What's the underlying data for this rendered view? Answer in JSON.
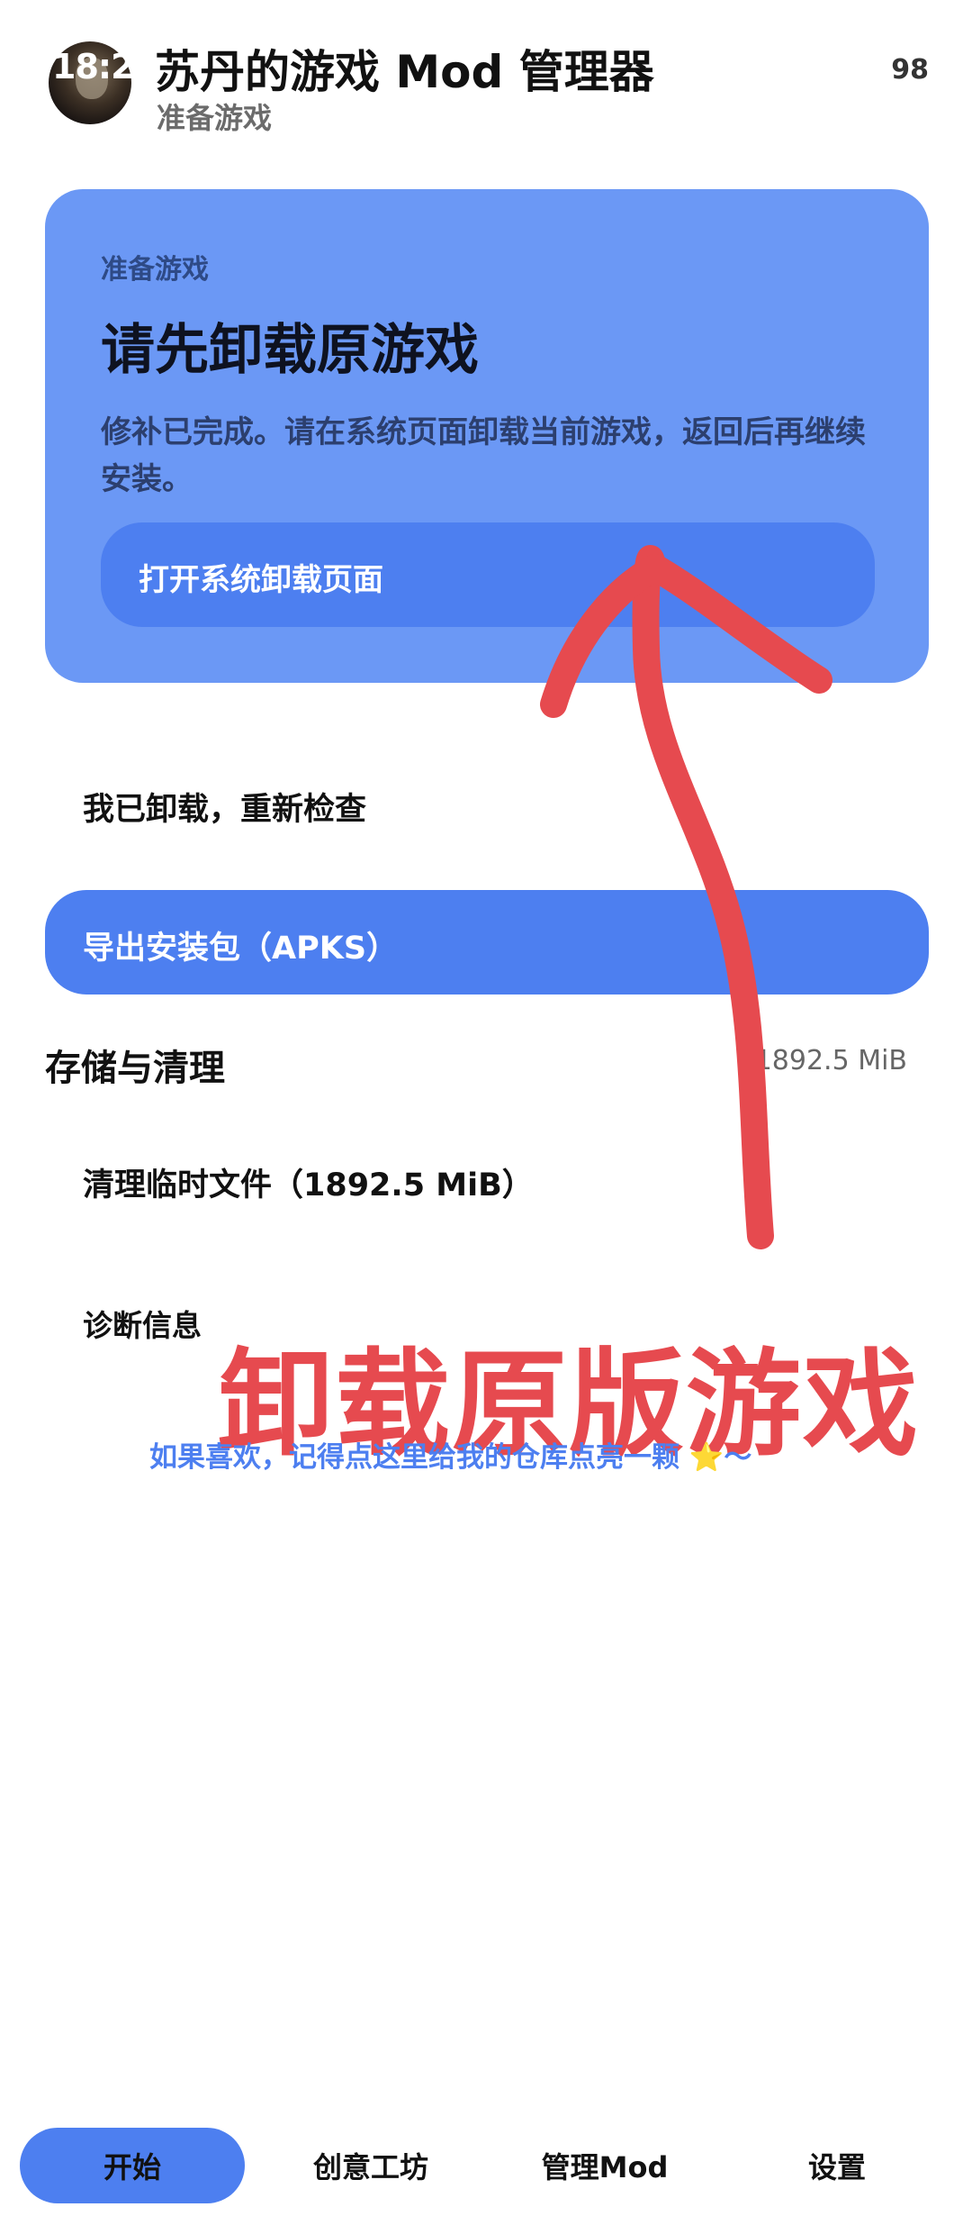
{
  "status": {
    "time": "18:2",
    "battery": "98"
  },
  "header": {
    "title": "苏丹的游戏 Mod 管理器",
    "subtitle": "准备游戏"
  },
  "card": {
    "eyebrow": "准备游戏",
    "title": "请先卸载原游戏",
    "description": "修补已完成。请在系统页面卸载当前游戏，返回后再继续安装。",
    "button_label": "打开系统卸载页面"
  },
  "actions": {
    "recheck_label": "我已卸载，重新检查",
    "export_label": "导出安装包（APKS）"
  },
  "storage": {
    "title": "存储与清理",
    "size": "1892.5 MiB",
    "clean_label": "清理临时文件（1892.5 MiB）",
    "diagnostics_label": "诊断信息"
  },
  "overlay": {
    "caption": "卸载原版游戏",
    "promo": "如果喜欢，记得点这里给我的仓库点亮一颗 ⭐～",
    "arrow_color": "#e64a4f"
  },
  "nav": {
    "items": [
      {
        "label": "开始",
        "active": true
      },
      {
        "label": "创意工坊",
        "active": false
      },
      {
        "label": "管理Mod",
        "active": false
      },
      {
        "label": "设置",
        "active": false
      }
    ]
  },
  "colors": {
    "accent": "#4d7ff0",
    "card_bg": "#6b98f5",
    "caption_red": "#e64a4f"
  }
}
